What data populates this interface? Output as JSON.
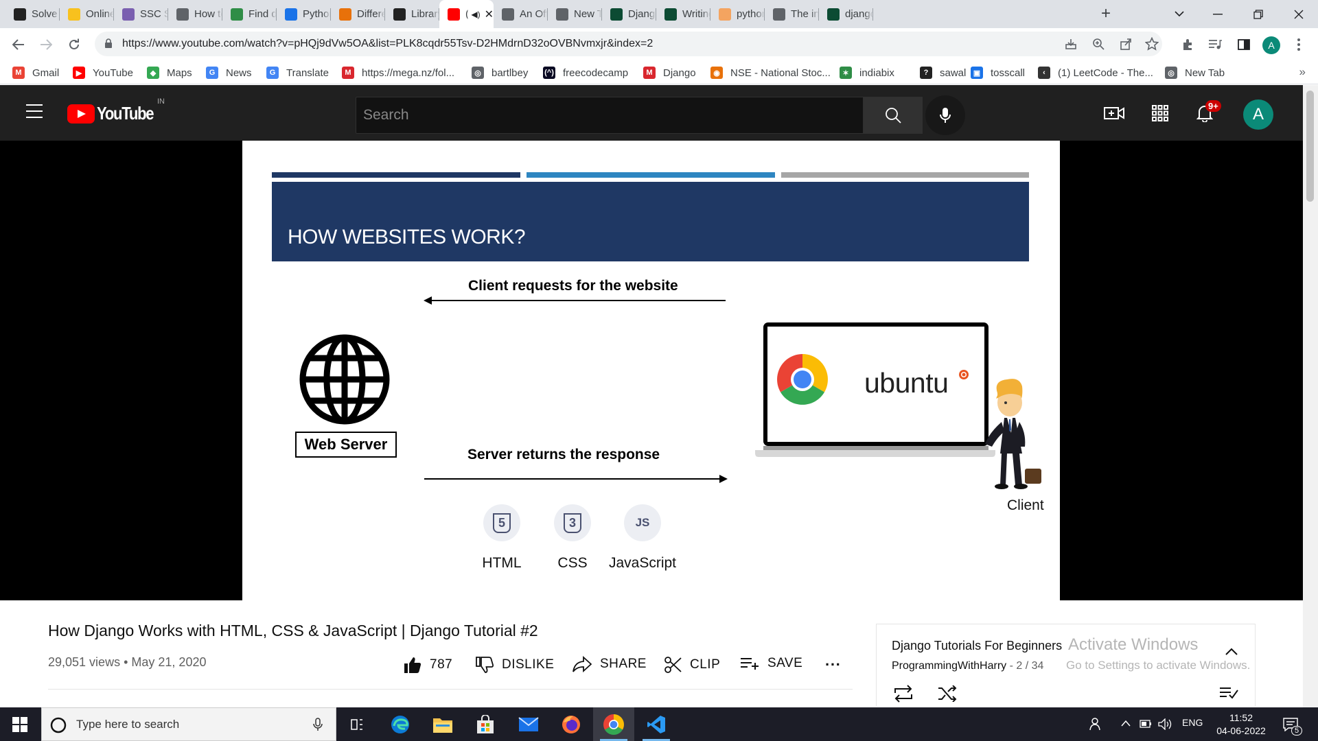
{
  "browser": {
    "tabs": [
      {
        "title": "Solve M",
        "icon_color": "#222222"
      },
      {
        "title": "Online",
        "icon_color": "#f8c11e"
      },
      {
        "title": "SSC Sel",
        "icon_color": "#7a5fb0"
      },
      {
        "title": "How to",
        "icon_color": "#5f6368"
      },
      {
        "title": "Find dif",
        "icon_color": "#2f8d46"
      },
      {
        "title": "Python",
        "icon_color": "#1a73e8"
      },
      {
        "title": "Differen",
        "icon_color": "#e8710a"
      },
      {
        "title": "Library",
        "icon_color": "#222222"
      },
      {
        "title": "(",
        "icon_color": "#ff0000",
        "active": true
      },
      {
        "title": "An Offi",
        "icon_color": "#5f6368"
      },
      {
        "title": "New Ta",
        "icon_color": "#5f6368"
      },
      {
        "title": "Django",
        "icon_color": "#0c4b33"
      },
      {
        "title": "Writing",
        "icon_color": "#0c4b33"
      },
      {
        "title": "python",
        "icon_color": "#f4a460"
      },
      {
        "title": "The ins",
        "icon_color": "#5f6368"
      },
      {
        "title": "django",
        "icon_color": "#0c4b33"
      }
    ],
    "url": "https://www.youtube.com/watch?v=pHQj9dVw5OA&list=PLK8cqdr55Tsv-D2HMdrnD32oOVBNvmxjr&index=2",
    "profile_initial": "A",
    "bookmarks": [
      {
        "label": "Gmail",
        "icon_color": "#ea4335",
        "glyph": "M"
      },
      {
        "label": "YouTube",
        "icon_color": "#ff0000",
        "glyph": "▶"
      },
      {
        "label": "Maps",
        "icon_color": "#34a853",
        "glyph": "◆"
      },
      {
        "label": "News",
        "icon_color": "#4285f4",
        "glyph": "G"
      },
      {
        "label": "Translate",
        "icon_color": "#4285f4",
        "glyph": "G"
      },
      {
        "label": "https://mega.nz/fol...",
        "icon_color": "#d9272e",
        "glyph": "M"
      },
      {
        "label": "bartlbey",
        "icon_color": "#5f6368",
        "glyph": "◎"
      },
      {
        "label": "freecodecamp",
        "icon_color": "#0a0a23",
        "glyph": "(^)"
      },
      {
        "label": "Django",
        "icon_color": "#d9272e",
        "glyph": "M"
      },
      {
        "label": "NSE - National Stoc...",
        "icon_color": "#e8710a",
        "glyph": "◉"
      },
      {
        "label": "indiabix",
        "icon_color": "#2f8d46",
        "glyph": "✶"
      },
      {
        "label": "sawal",
        "icon_color": "#222222",
        "glyph": "?"
      },
      {
        "label": "tosscall",
        "icon_color": "#1a73e8",
        "glyph": "▣"
      },
      {
        "label": "(1) LeetCode - The...",
        "icon_color": "#333333",
        "glyph": "‹"
      },
      {
        "label": "New Tab",
        "icon_color": "#5f6368",
        "glyph": "◎"
      }
    ],
    "bookmarks_overflow": "»"
  },
  "youtube": {
    "logo_text": "YouTube",
    "country_code": "IN",
    "search_placeholder": "Search",
    "notification_count": "9+",
    "avatar_initial": "A"
  },
  "slide": {
    "title": "HOW WEBSITES WORK?",
    "request_label": "Client requests for the website",
    "response_label": "Server returns the response",
    "server_label": "Web Server",
    "os_label": "ubuntu",
    "client_label": "Client",
    "tech": [
      {
        "label": "HTML",
        "glyph": "5"
      },
      {
        "label": "CSS",
        "glyph": "3"
      },
      {
        "label": "JavaScript",
        "glyph": "JS"
      }
    ],
    "colors": {
      "banner": "#1f3864",
      "bar1": "#1f3864",
      "bar2": "#2e86c1",
      "bar3": "#a6a6a6"
    }
  },
  "video": {
    "title": "How Django Works with HTML, CSS & JavaScript | Django Tutorial #2",
    "views": "29,051 views",
    "date": "May 21, 2020",
    "likes": "787",
    "dislike_label": "DISLIKE",
    "share_label": "SHARE",
    "clip_label": "CLIP",
    "save_label": "SAVE",
    "more_label": "···"
  },
  "playlist": {
    "title": "Django Tutorials For Beginners",
    "channel": "ProgrammingWithHarry",
    "position": "- 2 / 34"
  },
  "watermark": {
    "line1": "Activate Windows",
    "line2": "Go to Settings to activate Windows."
  },
  "taskbar": {
    "search_placeholder": "Type here to search",
    "language": "ENG",
    "time": "11:52",
    "date": "04-06-2022",
    "notification_count": "5"
  }
}
